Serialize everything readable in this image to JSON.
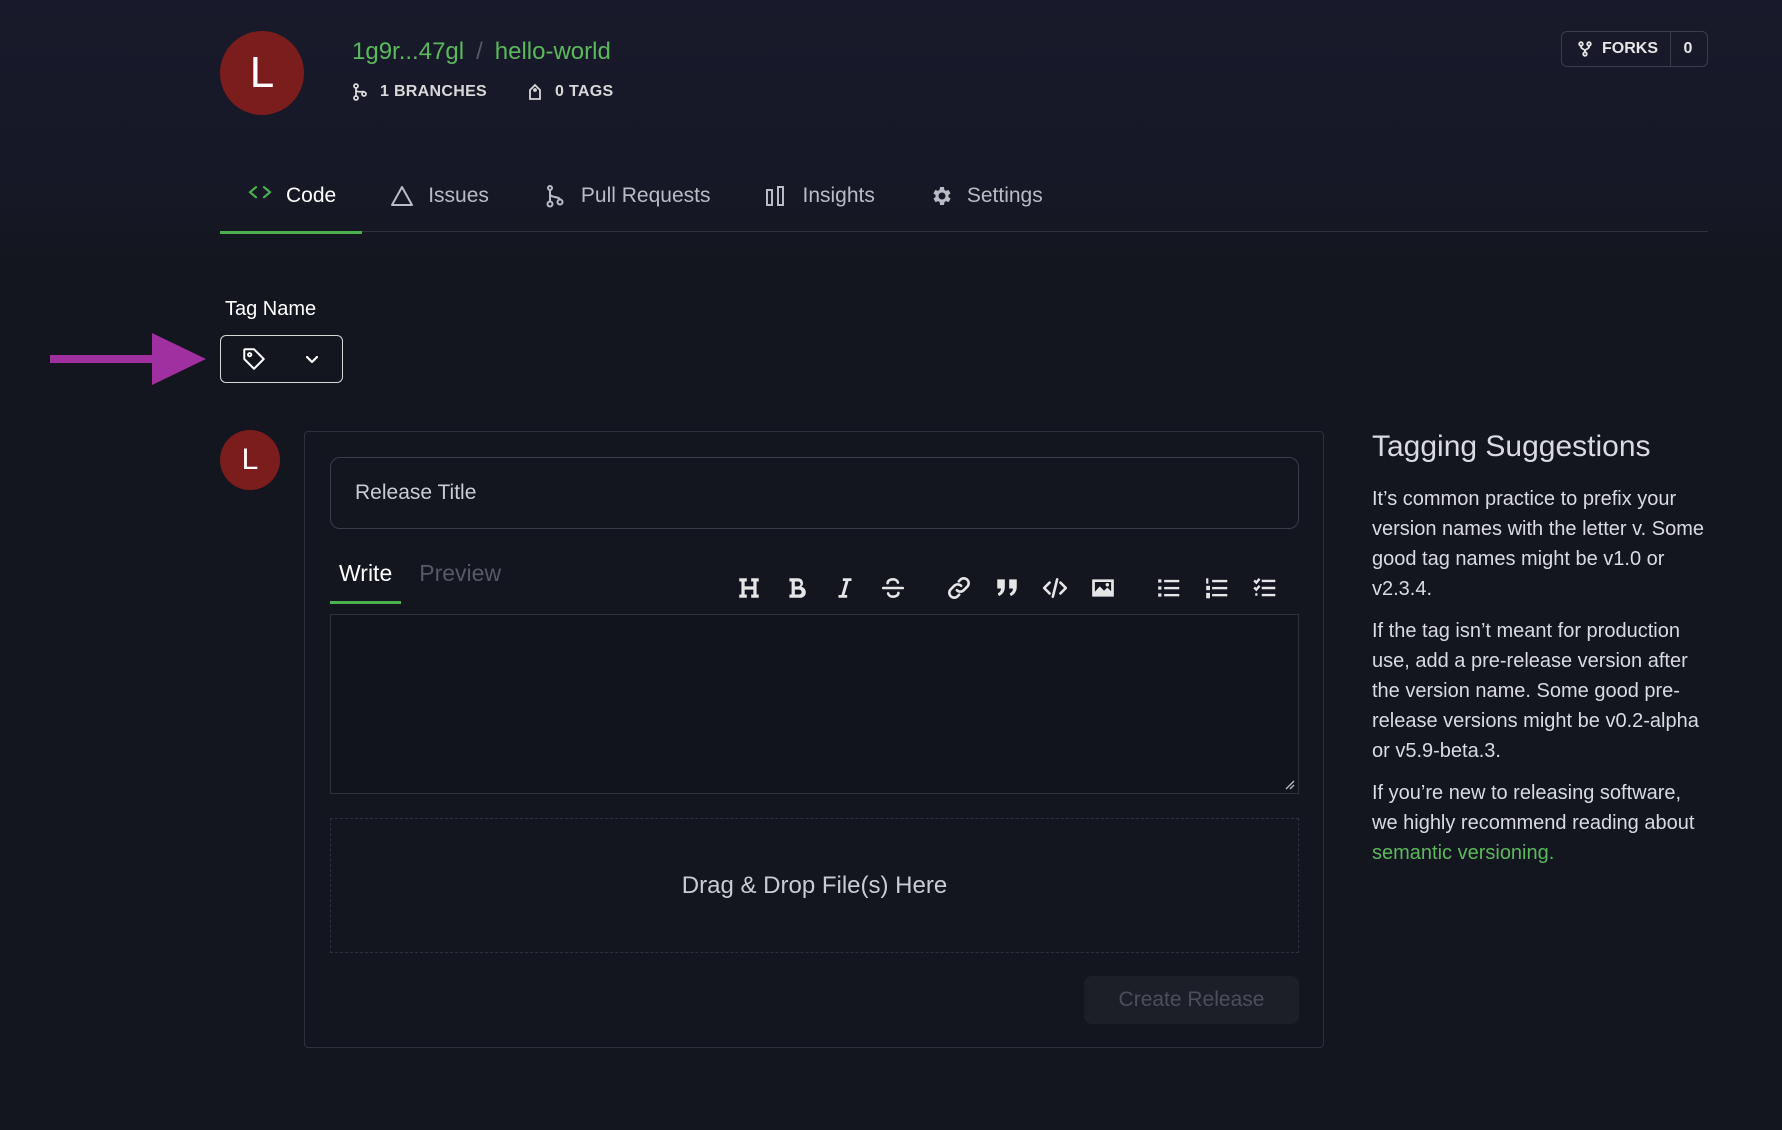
{
  "repo": {
    "avatar_letter": "L",
    "owner": "1g9r...47gl",
    "separator": "/",
    "name": "hello-world",
    "branches_label": "1 BRANCHES",
    "tags_label": "0 TAGS",
    "forks_label": "FORKS",
    "forks_count": "0"
  },
  "tabs": [
    {
      "label": "Code",
      "icon": "code-icon",
      "active": true
    },
    {
      "label": "Issues",
      "icon": "warning-triangle-icon"
    },
    {
      "label": "Pull Requests",
      "icon": "pull-request-icon"
    },
    {
      "label": "Insights",
      "icon": "bar-chart-icon"
    },
    {
      "label": "Settings",
      "icon": "gear-icon"
    }
  ],
  "tag": {
    "label": "Tag Name"
  },
  "form": {
    "avatar_letter": "L",
    "title_placeholder": "Release Title",
    "write_tab": "Write",
    "preview_tab": "Preview",
    "dropzone_text": "Drag & Drop File(s) Here",
    "create_button": "Create Release"
  },
  "toolbar": [
    "heading",
    "bold",
    "italic",
    "strikethrough",
    "link",
    "quote",
    "code",
    "image",
    "bullet-list",
    "numbered-list",
    "task-list"
  ],
  "suggestions": {
    "title": "Tagging Suggestions",
    "p1": "It’s common practice to prefix your version names with the letter v. Some good tag names might be v1.0 or v2.3.4.",
    "p2": "If the tag isn’t meant for production use, add a pre-release version after the version name. Some good pre-release versions might be v0.2-alpha or v5.9-beta.3.",
    "p3_prefix": "If you’re new to releasing software, we highly recommend reading about ",
    "p3_link": "semantic versioning."
  },
  "colors": {
    "accent_green": "#5cb85c",
    "avatar_red": "#7a1d1c",
    "annotation_arrow": "#a030a0"
  }
}
